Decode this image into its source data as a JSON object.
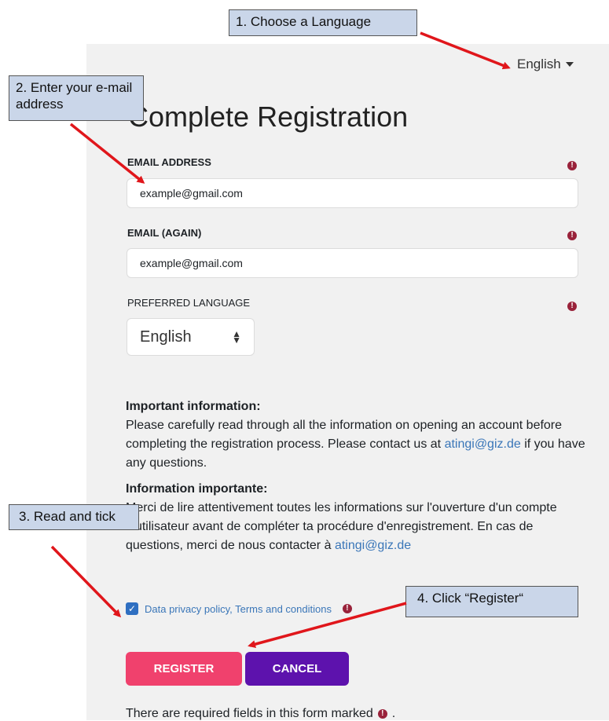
{
  "header": {
    "language_selector": "English"
  },
  "page": {
    "title": "Complete Registration"
  },
  "form": {
    "email_label": "EMAIL ADDRESS",
    "email_value": "example@gmail.com",
    "email_again_label": "EMAIL (AGAIN)",
    "email_again_value": "example@gmail.com",
    "pref_lang_label": "PREFERRED LANGUAGE",
    "pref_lang_value": "English",
    "info_en_heading": "Important information:",
    "info_en_text": "Please carefully read through all the information on opening an account before completing the registration process. Please contact us at",
    "info_en_link": "atingi@giz.de",
    "info_en_tail": "if you have any questions.",
    "info_fr_heading": "Information importante:",
    "info_fr_text": "Merci de lire attentivement toutes les informations sur l'ouverture d'un compte d'utilisateur avant de compléter ta procédure d'enregistrement. En cas de questions, merci de nous contacter à",
    "info_fr_link": "atingi@giz.de",
    "checkbox_label": "Data privacy policy, Terms and conditions",
    "register_label": "REGISTER",
    "cancel_label": "CANCEL",
    "required_note": "There are required fields in this form marked",
    "required_note_end": "."
  },
  "callouts": {
    "c1": "1. Choose a Language",
    "c2": "2. Enter your e-mail address",
    "c3": "3. Read and tick",
    "c4": "4. Click “Register“"
  },
  "colors": {
    "register": "#f0416d",
    "cancel": "#5d12ad",
    "required": "#99223a",
    "link": "#3a76b8",
    "callout": "#cad6e9",
    "arrow": "#e0161b"
  },
  "icons": {
    "required": "exclamation-circle-icon",
    "dropdown": "caret-down-icon",
    "checkbox": "check-icon"
  }
}
